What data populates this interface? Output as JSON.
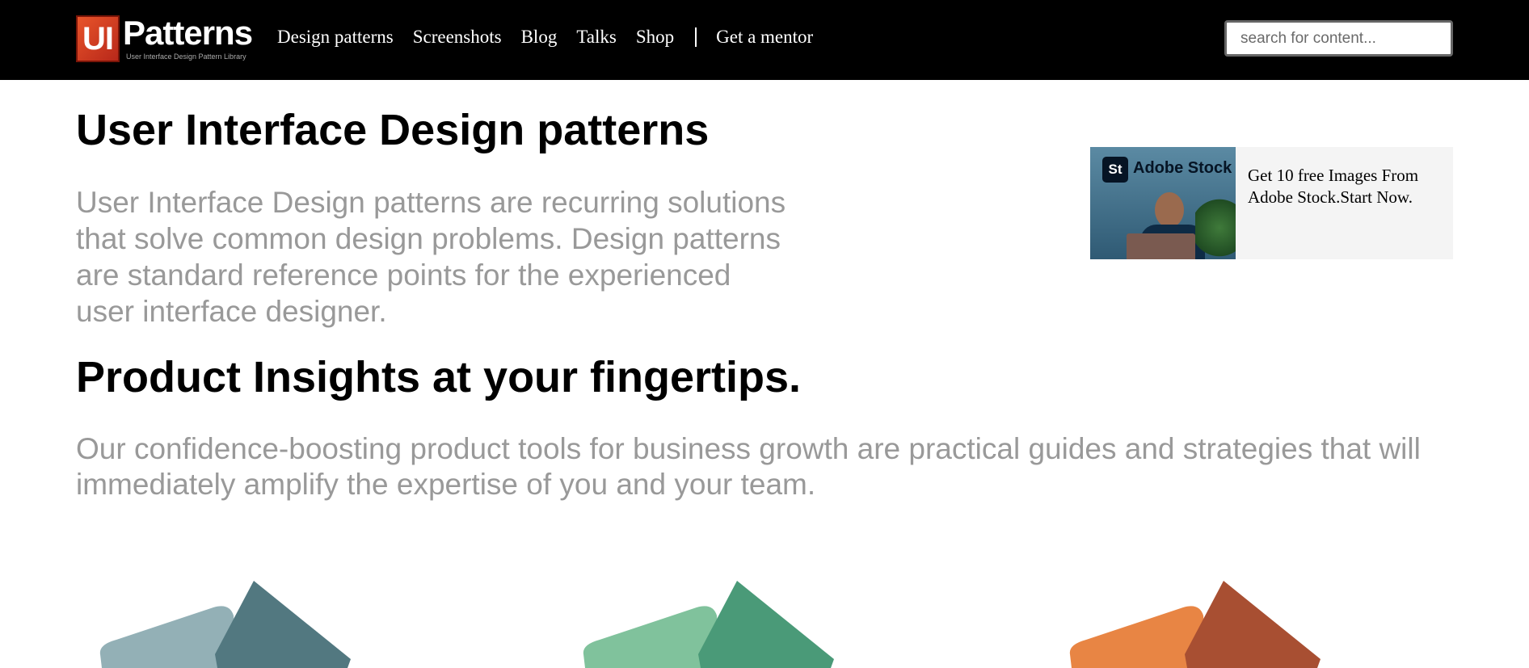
{
  "nav": {
    "logo_short": "UI",
    "logo_word": "Patterns",
    "logo_tagline": "User Interface Design Pattern Library",
    "items": [
      {
        "label": "Design patterns"
      },
      {
        "label": "Screenshots"
      },
      {
        "label": "Blog"
      },
      {
        "label": "Talks"
      },
      {
        "label": "Shop"
      }
    ],
    "mentor_label": "Get a mentor",
    "search_placeholder": "search for content..."
  },
  "main": {
    "title": "User Interface Design patterns",
    "intro": "User Interface Design patterns are recurring solutions that solve common design problems. Design patterns are standard reference points for the experienced user interface designer.",
    "subtitle": "Product Insights at your fingertips.",
    "subintro": "Our confidence-boosting product tools for business growth are practical guides and strategies that will immediately amplify the expertise of you and your team."
  },
  "ad": {
    "brand_badge": "St",
    "brand_name": "Adobe Stock",
    "text": "Get 10 free Images From Adobe Stock.Start Now."
  },
  "products": [
    {
      "name": "social-biases-cards",
      "card_color": "#93b0b6",
      "cover_color": "#527880"
    },
    {
      "name": "market-demand-cards",
      "card_color": "#80c29c",
      "cover_color": "#4a9a78"
    },
    {
      "name": "organizing-content-cards",
      "card_color": "#e88544",
      "cover_color": "#a84f32"
    }
  ]
}
